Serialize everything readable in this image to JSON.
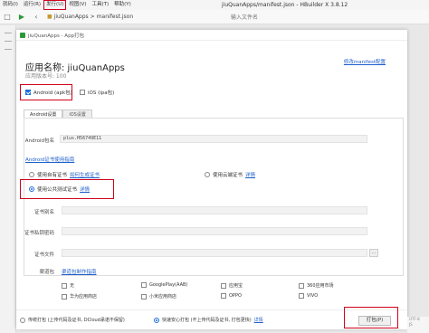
{
  "menubar": {
    "items": [
      "就码(I)",
      "运行(R)",
      "发行(U)",
      "视图(V)",
      "工具(T)",
      "帮助(Y)"
    ],
    "active_index": 2,
    "window_title": "jiuQuanApps/manifest.json - HBuilder X 3.8.12"
  },
  "toolbar": {
    "breadcrumb_project": "jiuQuanApps",
    "breadcrumb_sep": ">",
    "breadcrumb_file": "manifest.json",
    "search_placeholder": "输入文件名"
  },
  "dialog": {
    "title": "jiuQuanApps - App打包",
    "app_name": "应用名称: jiuQuanApps",
    "app_version": "应用版本号: 100",
    "manifest_link": "修改manifest配置",
    "platforms": [
      {
        "label": "Android (apk包)",
        "checked": true
      },
      {
        "label": "iOS (ipa包)",
        "checked": false
      }
    ],
    "tabs": [
      "Android设置",
      "iOS设置"
    ],
    "active_tab": 0,
    "package_label": "Android包名",
    "package_value": "plus.H56749E11",
    "cert_link": "Android证书使用指南",
    "cert_options": [
      {
        "label": "使用自有证书",
        "link": "如何生成证书",
        "checked": false
      },
      {
        "label": "使用云端证书",
        "link": "详情",
        "checked": false
      },
      {
        "label": "使用公共测试证书",
        "link": "详情",
        "checked": true
      }
    ],
    "fields": [
      {
        "label": "证书别名",
        "value": ""
      },
      {
        "label": "证书私钥密码",
        "value": ""
      },
      {
        "label": "证书文件",
        "value": ""
      }
    ],
    "browse_label": "...",
    "channel_label": "渠道包",
    "channel_link": "渠道包制作指南",
    "channels": [
      "无",
      "GooglePlay(AAB)",
      "应用宝",
      "360应用市场",
      "华为应用商店",
      "小米应用商店",
      "OPPO",
      "VIVO"
    ],
    "footer": {
      "mode_options": [
        {
          "label": "传统打包 (上传代码及证书, DCloud承诺不保留)",
          "checked": false
        },
        {
          "label": "快速安心打包 (不上传代码及证书, 打包更快)",
          "checked": true
        }
      ],
      "detail_link": "详情",
      "pack_button": "打包(P)"
    }
  },
  "statusbar": {
    "encoding": "UTF-8",
    "lang": "JS"
  }
}
